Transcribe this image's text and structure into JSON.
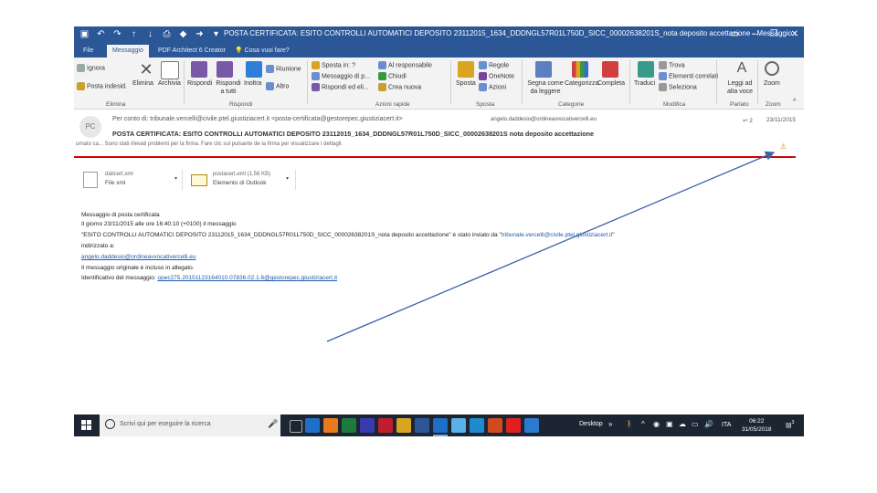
{
  "window": {
    "title": "POSTA CERTIFICATA: ESITO CONTROLLI AUTOMATICI DEPOSITO 23112015_1634_DDDNGL57R01L750D_SICC_00002638201S_nota deposito accettazione - Messaggio...",
    "qat_icons": [
      "save-icon",
      "undo-icon",
      "redo-icon",
      "up-icon",
      "down-icon",
      "print-icon",
      "color-icon",
      "forward-icon",
      "customize-icon"
    ],
    "controls": [
      "minimize-icon",
      "restore-icon",
      "close-icon"
    ]
  },
  "tabs": [
    {
      "label": "File"
    },
    {
      "label": "Messaggio"
    },
    {
      "label": "PDF Architect 6 Creator"
    },
    {
      "label": "Cosa vuoi fare?"
    }
  ],
  "ribbon": {
    "delete_group": {
      "ignore": "Ignora",
      "junk": "Posta indesid.",
      "delete": "Elimina",
      "archive": "Archivia",
      "label": "Elimina"
    },
    "respond_group": {
      "reply": "Rispondi",
      "reply_all": "Rispondi a tutti",
      "forward": "Inoltra",
      "more": "Altro",
      "meeting": "Riunione",
      "label": "Rispondi"
    },
    "quick_steps": {
      "move_to": "Sposta in: ?",
      "to_manager": "Al responsabile",
      "team_email": "Messaggio di p...",
      "done": "Chiudi",
      "reply_delete": "Rispondi ed eli...",
      "create_new": "Crea nuova",
      "label": "Azioni rapide"
    },
    "move_group": {
      "move": "Sposta",
      "rules": "Regole",
      "onenote": "OneNote",
      "actions": "Azioni",
      "label": "Sposta"
    },
    "tags_group": {
      "mark_unread": "Segna come da leggere",
      "categorize": "Categorizza",
      "follow_up": "Completa",
      "label": "Categorie"
    },
    "editing_group": {
      "translate": "Traduci",
      "find": "Trova",
      "related": "Elementi correlati",
      "select": "Seleziona",
      "label": "Modifica"
    },
    "speech_group": {
      "read_aloud": "Leggi ad alta voce",
      "label": "Parlato"
    },
    "zoom_group": {
      "zoom": "Zoom",
      "label": "Zoom"
    }
  },
  "header": {
    "avatar": "PC",
    "from": "Per conto di: tribunale.vercelli@civile.ptel.giustiziacert.it <posta-certificata@gestorepec.giustiziacert.it>",
    "to": "angelo.daddesio@ordineavvocativercelli.eu",
    "count": "2",
    "date": "23/11/2015",
    "subject": "POSTA CERTIFICATA: ESITO CONTROLLI AUTOMATICI DEPOSITO 23112015_1634_DDDNGL57R01L750D_SICC_00002638201S nota deposito accettazione",
    "notice": "urnato ca... Sono stati rilevati problemi per la firma. Fare clic sul pulsante de la firma per visualizzare i dettagli."
  },
  "attachments": [
    {
      "name": "daticert.xml",
      "desc": "File xml"
    },
    {
      "name": "postacert.eml (1,56 KB)",
      "desc": "Elemento di Outlook"
    }
  ],
  "body": {
    "line1": "Messaggio di posta certificata",
    "line2": "Il giorno 23/11/2015 alle ore 16:40:10 (+0100) il messaggio",
    "line3a": "\"ESITO CONTROLLI AUTOMATICI DEPOSITO 23112015_1634_DDDNGL57R01L750D_SICC_00002638201S_nota deposito accettazione\" è stato inviato da \"",
    "line3b": "tribunale.vercelli@civile.ptel.giustiziacert.it",
    "line3c": "\"",
    "line4": "indirizzato a:",
    "line5": "angelo.daddesio@ordineavvocativercelli.eu",
    "line6": "Il messaggio originale è incluso in allegato.",
    "line7a": "Identificativo del messaggio: ",
    "line7b": "opec275.20151123164010.07836.02.1.6@gestorepec.giustiziacert.it"
  },
  "taskbar": {
    "search_placeholder": "Scrivi qui per eseguire la ricerca",
    "desktop_label": "Desktop",
    "lang": "ITA",
    "time": "06:22",
    "date": "31/05/2018",
    "notif_count": "3"
  },
  "colors": {
    "title_bar": "#2b5797",
    "ribbon_bg": "#f3f3f3",
    "red_line": "#d40000",
    "link": "#1e5aa8",
    "taskbar": "#1c2633",
    "arrow": "#3b63a8"
  }
}
